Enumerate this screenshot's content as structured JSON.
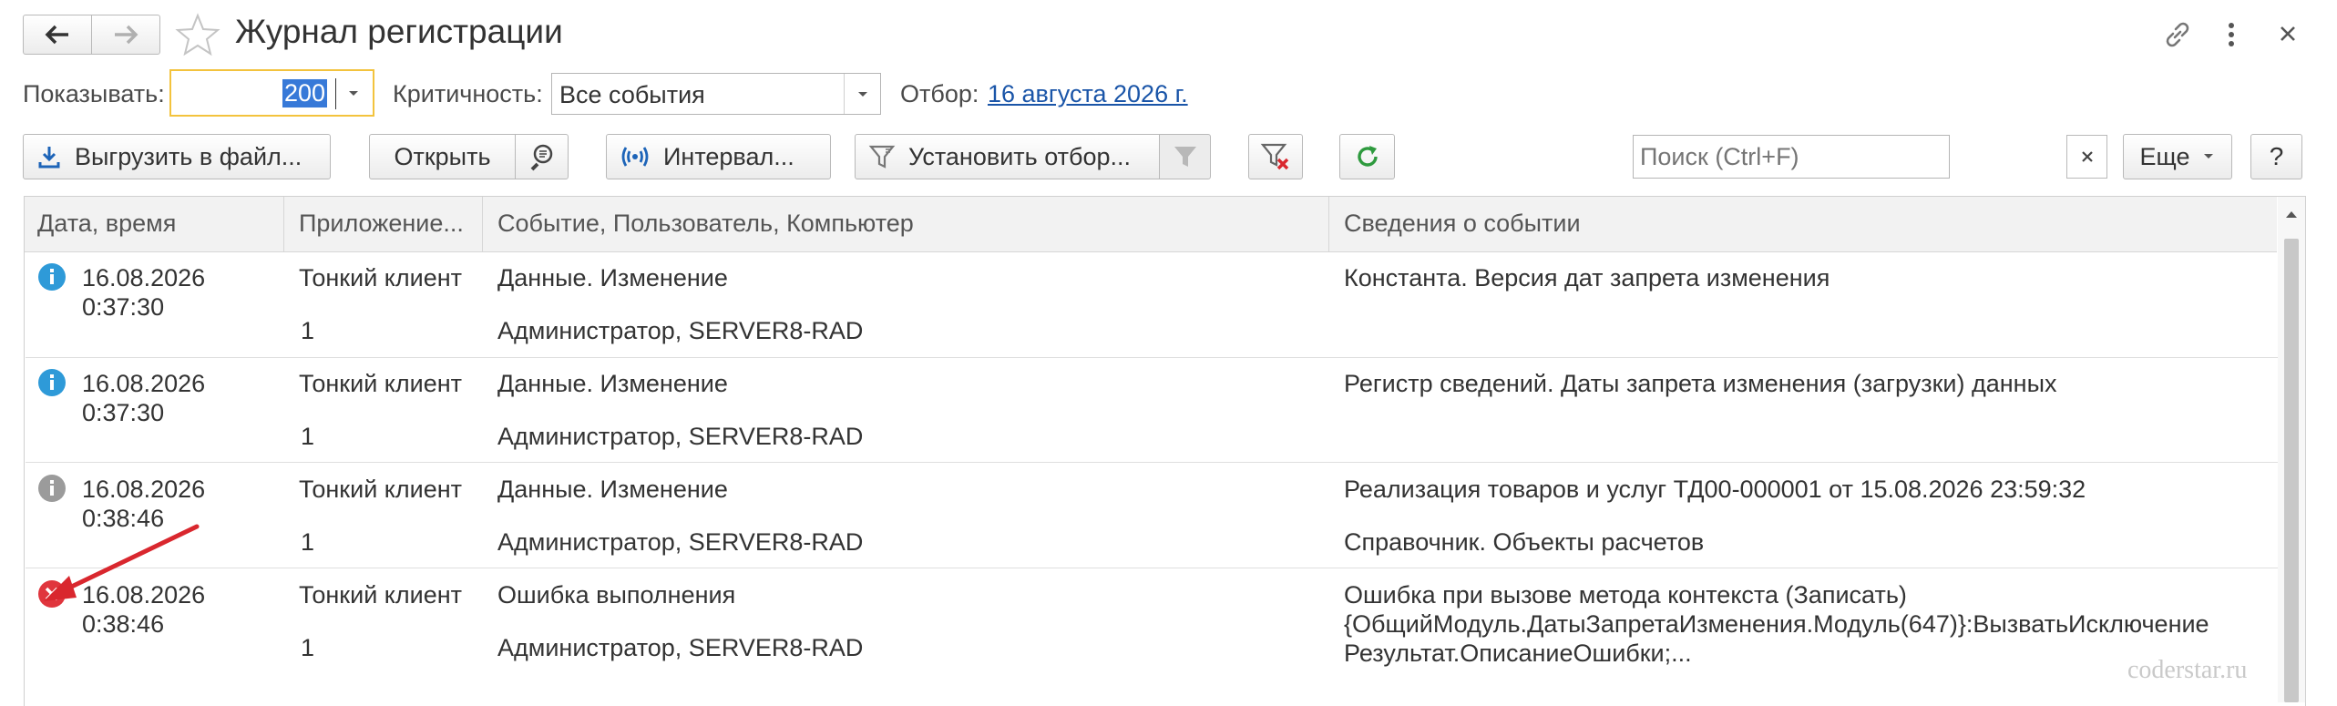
{
  "window": {
    "title": "Журнал регистрации"
  },
  "filters": {
    "show_label": "Показывать:",
    "show_value": "200",
    "severity_label": "Критичность:",
    "severity_value": "Все события",
    "selection_label": "Отбор:",
    "selection_link": "16 августа 2026 г."
  },
  "toolbar": {
    "export_label": "Выгрузить в файл...",
    "open_label": "Открыть",
    "interval_label": "Интервал...",
    "set_filter_label": "Установить отбор...",
    "search_placeholder": "Поиск (Ctrl+F)",
    "more_label": "Еще",
    "help_label": "?"
  },
  "table": {
    "columns": [
      "Дата, время",
      "Приложение...",
      "Событие, Пользователь, Компьютер",
      "Сведения о событии"
    ],
    "rows": [
      {
        "level": "info",
        "date": "16.08.2026",
        "time": "0:37:30",
        "app": "Тонкий клиент",
        "session": "1",
        "event": "Данные. Изменение",
        "user": "Администратор, SERVER8-RAD",
        "details": [
          "Константа. Версия дат запрета изменения"
        ]
      },
      {
        "level": "info",
        "date": "16.08.2026",
        "time": "0:37:30",
        "app": "Тонкий клиент",
        "session": "1",
        "event": "Данные. Изменение",
        "user": "Администратор, SERVER8-RAD",
        "details": [
          "Регистр сведений. Даты запрета изменения (загрузки) данных"
        ]
      },
      {
        "level": "note",
        "date": "16.08.2026",
        "time": "0:38:46",
        "app": "Тонкий клиент",
        "session": "1",
        "event": "Данные. Изменение",
        "user": "Администратор, SERVER8-RAD",
        "details": [
          "Реализация товаров и услуг ТД00-000001 от 15.08.2026 23:59:32",
          "Справочник. Объекты расчетов"
        ]
      },
      {
        "level": "error",
        "date": "16.08.2026",
        "time": "0:38:46",
        "app": "Тонкий клиент",
        "session": "1",
        "event": "Ошибка выполнения",
        "user": "Администратор, SERVER8-RAD",
        "details": [
          "Ошибка при вызове метода контекста (Записать)",
          "{ОбщийМодуль.ДатыЗапретаИзменения.Модуль(647)}:ВызватьИсключение",
          "Результат.ОписаниеОшибки;..."
        ]
      }
    ]
  },
  "watermark": "coderstar.ru",
  "colors": {
    "info": "#2e9ad8",
    "note": "#9b9b9b",
    "error": "#e0353d",
    "link": "#1a55a8",
    "accent_border": "#f3c33d",
    "arrow": "#d9272e"
  }
}
